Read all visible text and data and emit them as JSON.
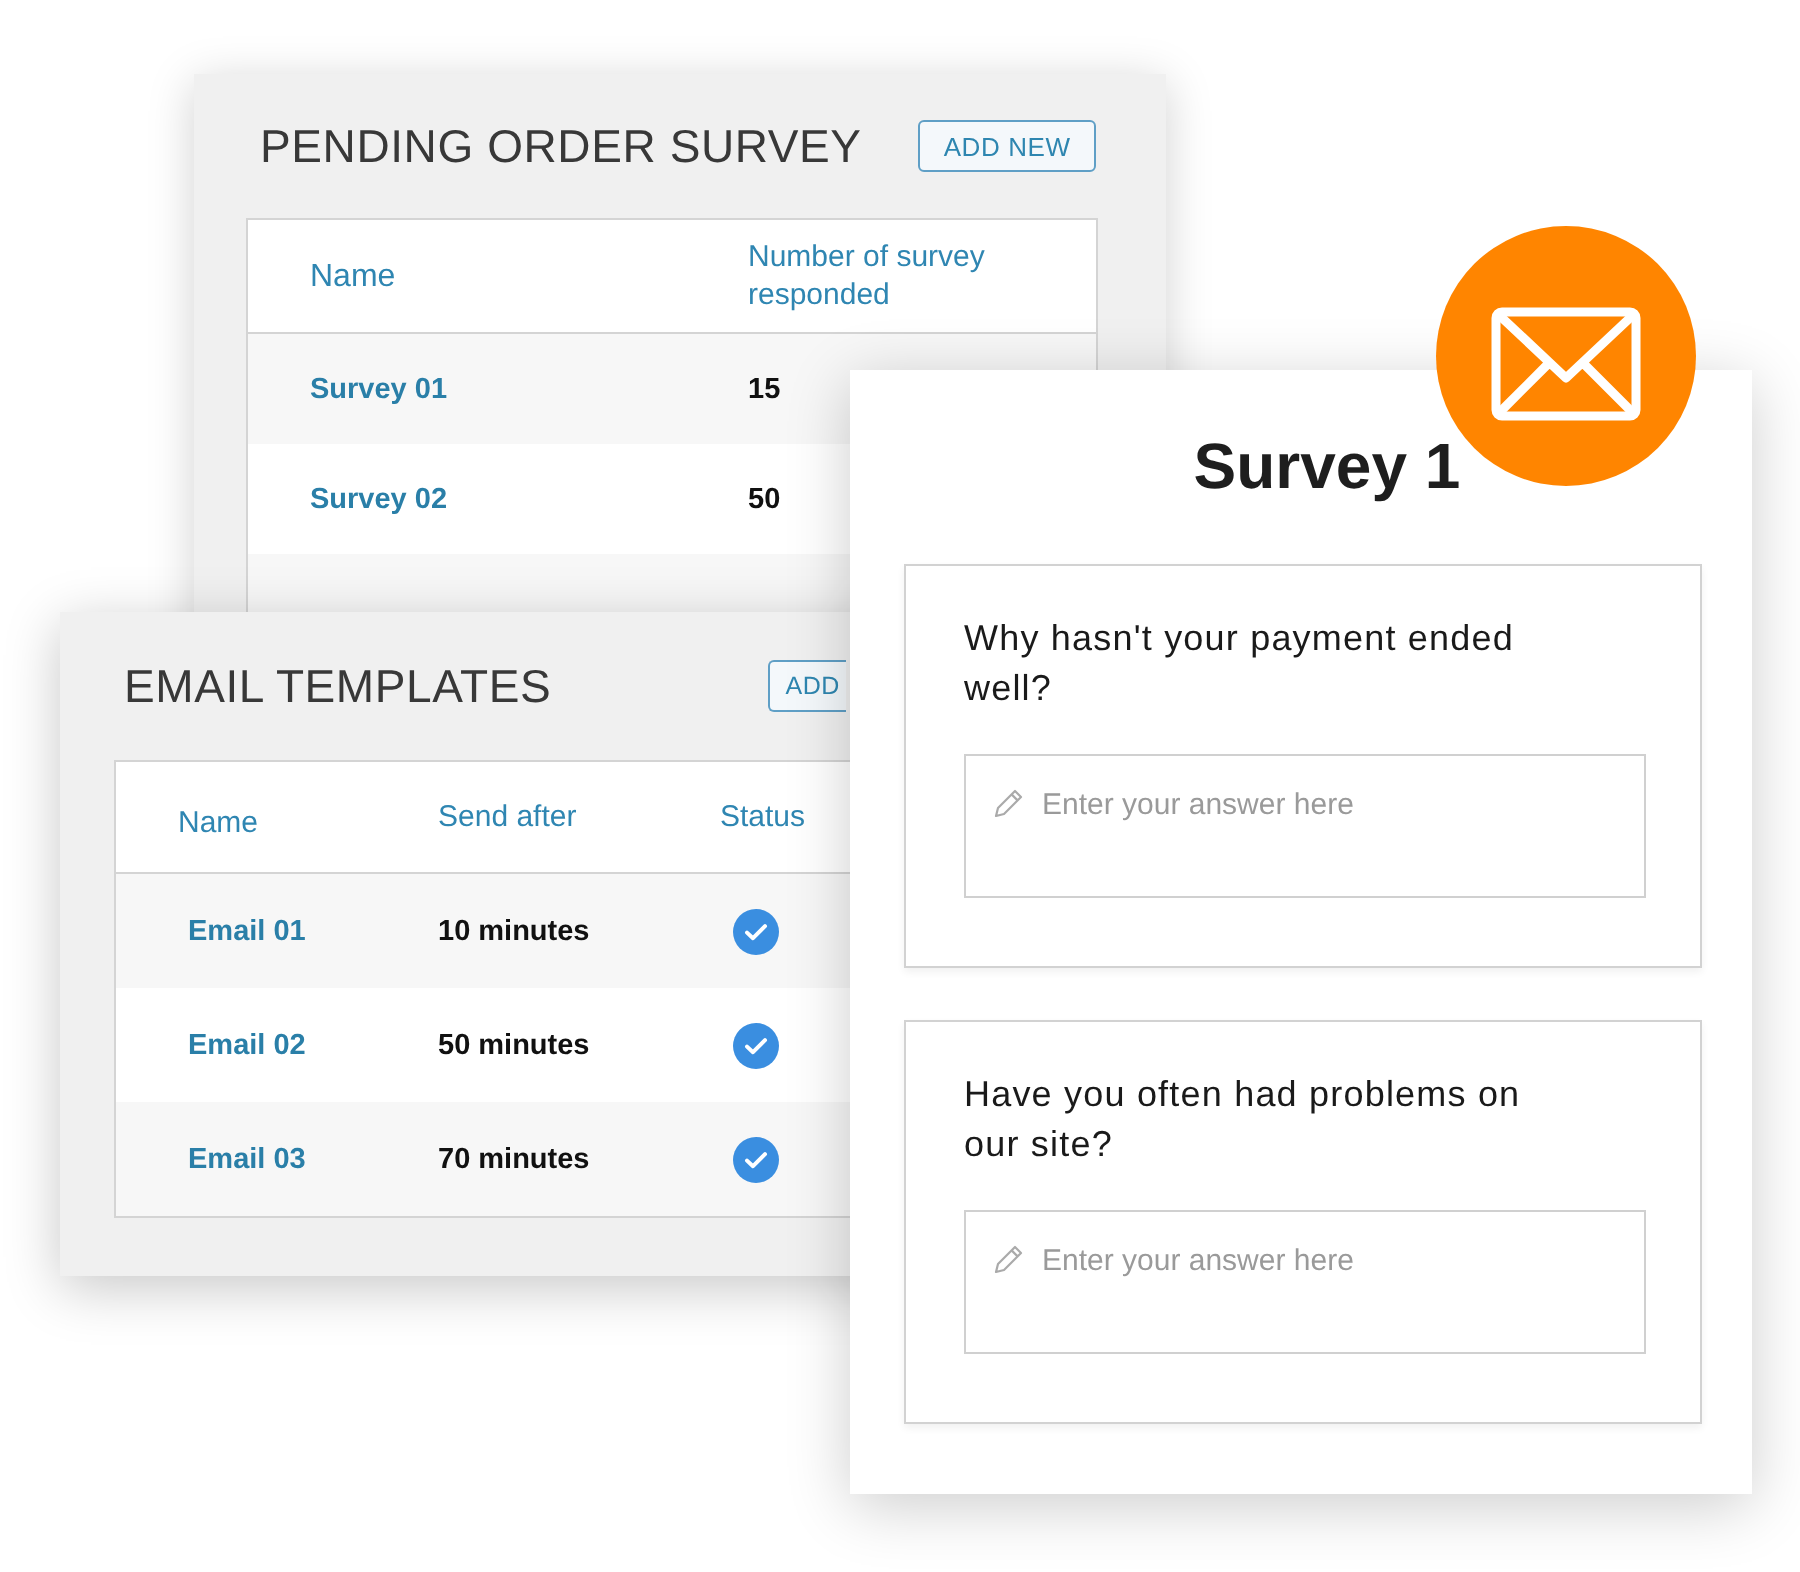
{
  "pending_survey": {
    "title": "PENDING ORDER SURVEY",
    "button": "ADD NEW",
    "columns": [
      "Name",
      "Number of survey responded"
    ],
    "rows": [
      {
        "name": "Survey 01",
        "count": "15"
      },
      {
        "name": "Survey 02",
        "count": "50"
      }
    ]
  },
  "email_templates": {
    "title": "EMAIL TEMPLATES",
    "button": "ADD",
    "columns": [
      "Name",
      "Send after",
      "Status"
    ],
    "rows": [
      {
        "name": "Email 01",
        "send_after": "10 minutes",
        "active": true
      },
      {
        "name": "Email 02",
        "send_after": "50 minutes",
        "active": true
      },
      {
        "name": "Email 03",
        "send_after": "70 minutes",
        "active": true
      }
    ]
  },
  "survey": {
    "title": "Survey 1",
    "questions": [
      {
        "text": "Why hasn't your payment ended well?",
        "placeholder": "Enter your answer here"
      },
      {
        "text": "Have you often had problems on our site?",
        "placeholder": "Enter your answer here"
      }
    ]
  }
}
